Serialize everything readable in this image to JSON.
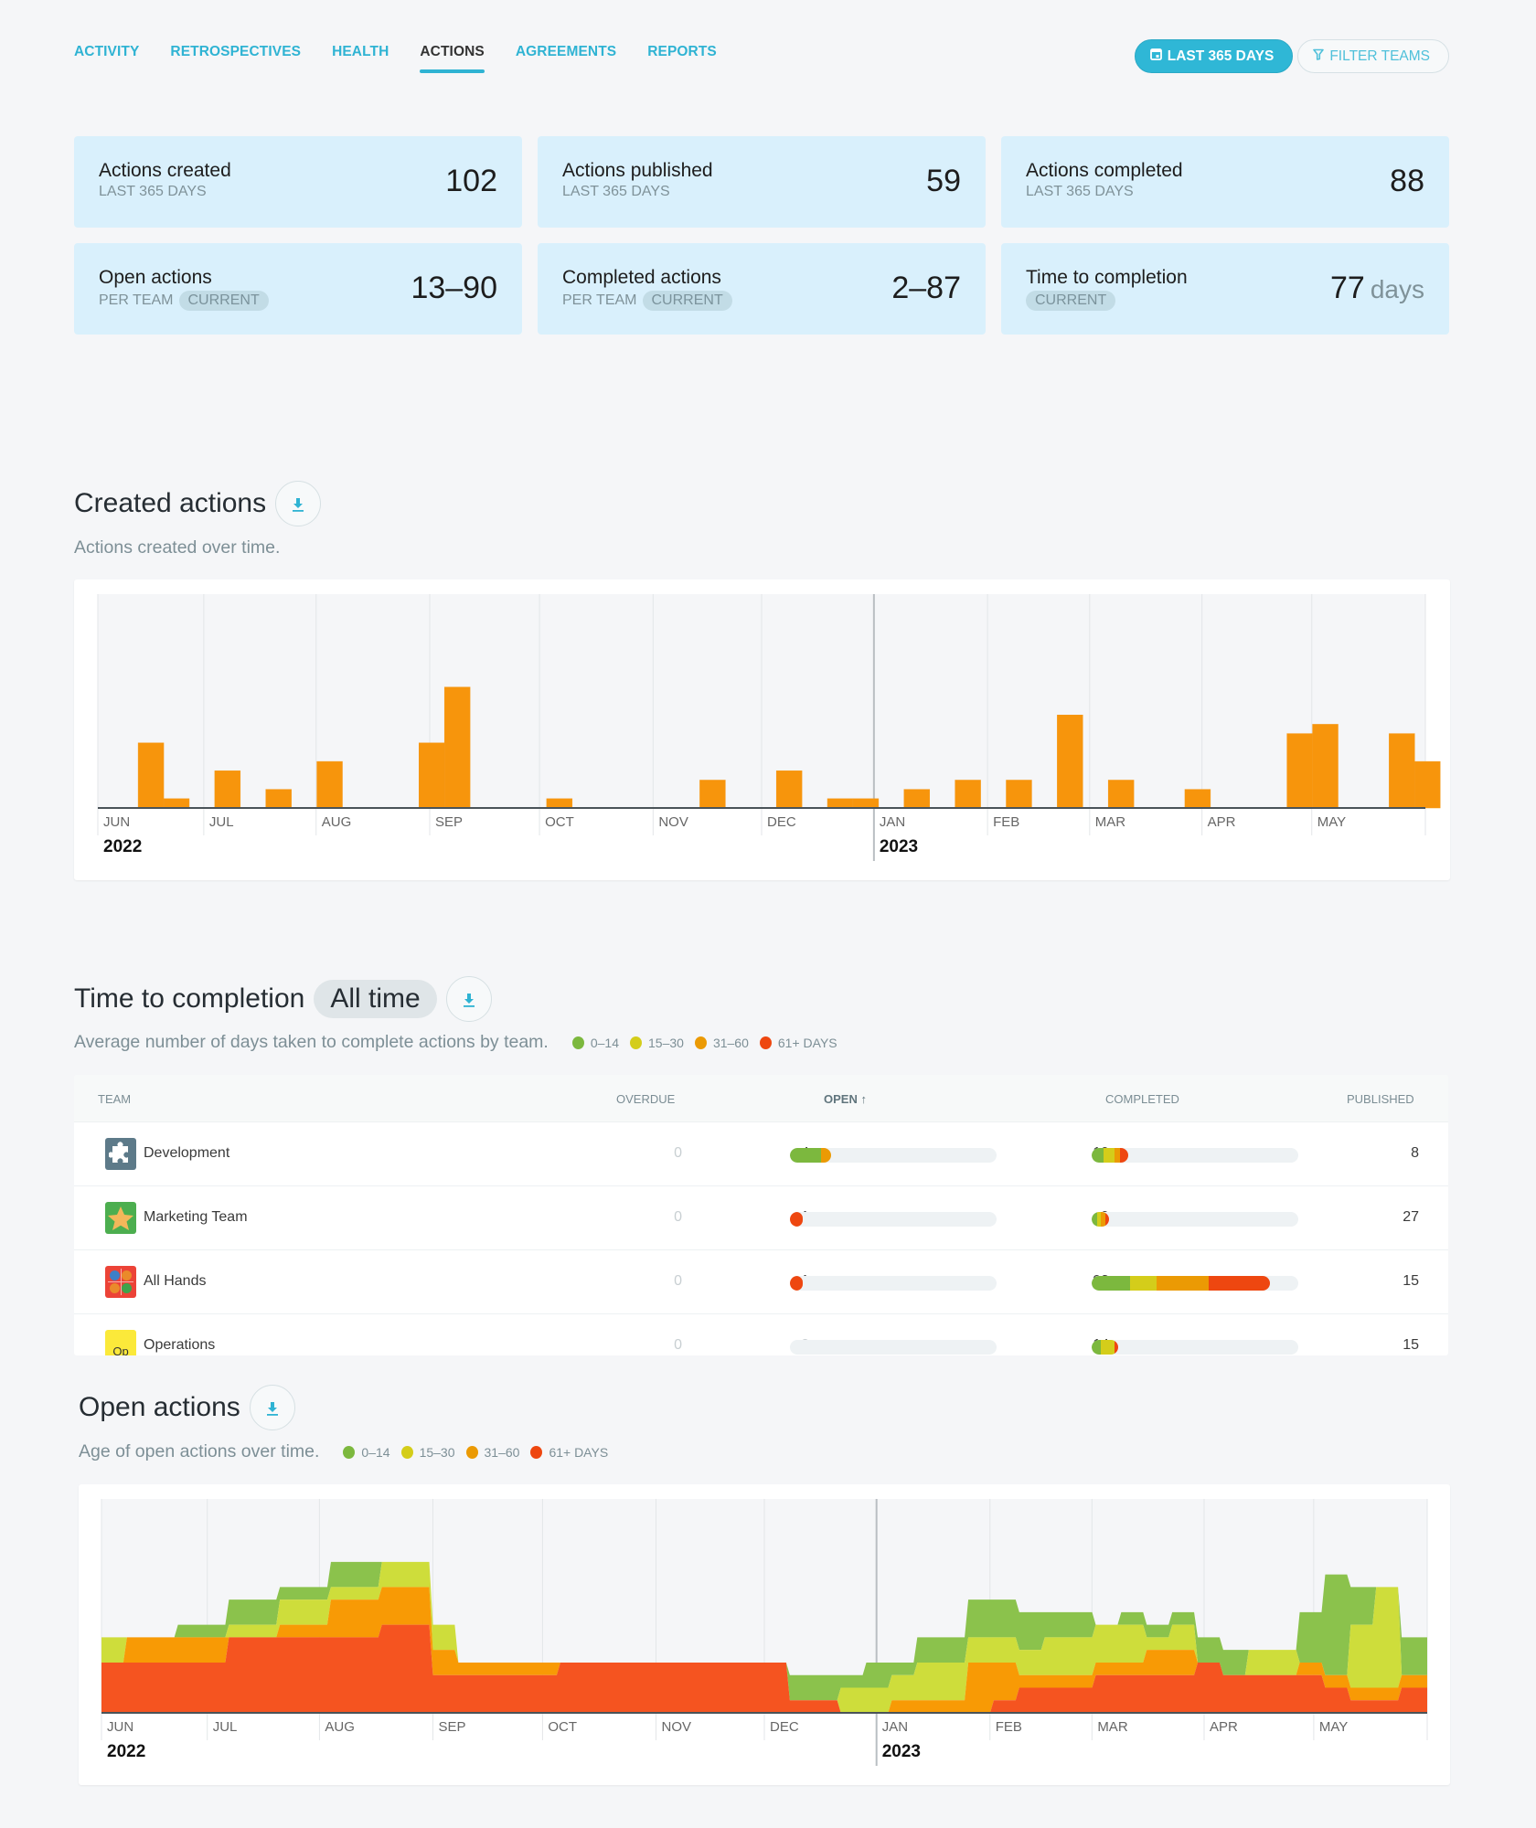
{
  "tabs": [
    {
      "label": "ACTIVITY",
      "active": false
    },
    {
      "label": "RETROSPECTIVES",
      "active": false
    },
    {
      "label": "HEALTH",
      "active": false
    },
    {
      "label": "ACTIONS",
      "active": true
    },
    {
      "label": "AGREEMENTS",
      "active": false
    },
    {
      "label": "REPORTS",
      "active": false
    }
  ],
  "toolbar": {
    "date_range_label": "LAST 365 DAYS",
    "filter_label": "FILTER TEAMS"
  },
  "cards": [
    {
      "title": "Actions created",
      "subtitle": "LAST 365 DAYS",
      "badge": "",
      "value": "102",
      "unit": ""
    },
    {
      "title": "Actions published",
      "subtitle": "LAST 365 DAYS",
      "badge": "",
      "value": "59",
      "unit": ""
    },
    {
      "title": "Actions completed",
      "subtitle": "LAST 365 DAYS",
      "badge": "",
      "value": "88",
      "unit": ""
    },
    {
      "title": "Open actions",
      "subtitle": "PER TEAM",
      "badge": "CURRENT",
      "value": "13–90",
      "unit": ""
    },
    {
      "title": "Completed actions",
      "subtitle": "PER TEAM",
      "badge": "CURRENT",
      "value": "2–87",
      "unit": ""
    },
    {
      "title": "Time to completion",
      "subtitle": "",
      "badge": "CURRENT",
      "value": "77",
      "unit": "days"
    }
  ],
  "created_section": {
    "title": "Created actions",
    "description": "Actions created over time."
  },
  "completion_section": {
    "title": "Time to completion",
    "period_badge": "All time",
    "description": "Average number of days taken to complete actions by team."
  },
  "open_section": {
    "title": "Open actions",
    "description": "Age of open actions over time."
  },
  "legend": [
    {
      "label": "0–14",
      "color": "#7cb83e"
    },
    {
      "label": "15–30",
      "color": "#d4cd1a"
    },
    {
      "label": "31–60",
      "color": "#eb9a04"
    },
    {
      "label": "61+ DAYS",
      "color": "#ee4710"
    }
  ],
  "table": {
    "columns": {
      "team": "TEAM",
      "overdue": "OVERDUE",
      "open": "OPEN",
      "open_sort": "↑",
      "completed": "COMPLETED",
      "published": "PUBLISHED"
    },
    "open_scale_max": 20,
    "completed_scale_max": 108,
    "rows": [
      {
        "team": "Development",
        "icon": "puzzle-icon",
        "overdue": "0",
        "open": "4",
        "open_segments": [
          3,
          0,
          1,
          0
        ],
        "completed": "19",
        "completed_segments": [
          6,
          6,
          3,
          4
        ],
        "published": "8"
      },
      {
        "team": "Marketing Team",
        "icon": "star-icon",
        "overdue": "0",
        "open": "1",
        "open_segments": [
          0,
          0,
          0,
          1
        ],
        "completed": "9",
        "completed_segments": [
          3,
          2,
          2,
          2
        ],
        "published": "27"
      },
      {
        "team": "All Hands",
        "icon": "faces-grid-icon",
        "overdue": "0",
        "open": "1",
        "open_segments": [
          0,
          0,
          0,
          1
        ],
        "completed": "93",
        "completed_segments": [
          20,
          14,
          27,
          32
        ],
        "published": "15"
      },
      {
        "team": "Operations",
        "icon": "op-initials-icon",
        "icon_text": "Op",
        "overdue": "0",
        "open": "0",
        "open_segments": [
          0,
          0,
          0,
          0
        ],
        "completed": "14",
        "completed_segments": [
          5,
          7,
          0,
          2
        ],
        "published": "15"
      }
    ]
  },
  "chart_data": [
    {
      "type": "bar",
      "title": "Created actions",
      "xlabel": "",
      "ylabel": "",
      "x_unit": "week",
      "weeks_total": 52,
      "months": [
        "JUN",
        "JUL",
        "AUG",
        "SEP",
        "OCT",
        "NOV",
        "DEC",
        "JAN",
        "FEB",
        "MAR",
        "APR",
        "MAY"
      ],
      "month_start_weeks": [
        0,
        4.15,
        8.55,
        13,
        17.3,
        21.75,
        26,
        30.4,
        34.85,
        38.85,
        43.25,
        47.55
      ],
      "years": [
        {
          "label": "2022",
          "month_index": 0
        },
        {
          "label": "2023",
          "month_index": 7
        }
      ],
      "color": "#f7950c",
      "bars": [
        {
          "week": 1,
          "value": 7
        },
        {
          "week": 2,
          "value": 1
        },
        {
          "week": 4,
          "value": 4
        },
        {
          "week": 6,
          "value": 2
        },
        {
          "week": 8,
          "value": 5
        },
        {
          "week": 12,
          "value": 7
        },
        {
          "week": 13,
          "value": 13
        },
        {
          "week": 17,
          "value": 1
        },
        {
          "week": 23,
          "value": 3
        },
        {
          "week": 26,
          "value": 4
        },
        {
          "week": 28,
          "value": 1
        },
        {
          "week": 29,
          "value": 1
        },
        {
          "week": 31,
          "value": 2
        },
        {
          "week": 33,
          "value": 3
        },
        {
          "week": 35,
          "value": 3
        },
        {
          "week": 37,
          "value": 10
        },
        {
          "week": 39,
          "value": 3
        },
        {
          "week": 42,
          "value": 2
        },
        {
          "week": 46,
          "value": 8
        },
        {
          "week": 47,
          "value": 9
        },
        {
          "week": 50,
          "value": 8
        },
        {
          "week": 51,
          "value": 5
        }
      ],
      "ylim": [
        0,
        23
      ]
    },
    {
      "type": "area",
      "stacked": true,
      "title": "Open actions",
      "x_unit": "week",
      "weeks_total": 52,
      "months": [
        "JUN",
        "JUL",
        "AUG",
        "SEP",
        "OCT",
        "NOV",
        "DEC",
        "JAN",
        "FEB",
        "MAR",
        "APR",
        "MAY"
      ],
      "month_start_weeks": [
        0,
        4.15,
        8.55,
        13,
        17.3,
        21.75,
        26,
        30.4,
        34.85,
        38.85,
        43.25,
        47.55
      ],
      "years": [
        {
          "label": "2022",
          "month_index": 0
        },
        {
          "label": "2023",
          "month_index": 7
        }
      ],
      "ylim": [
        0,
        17
      ],
      "series": [
        {
          "name": "61+ DAYS",
          "color": "#f55420",
          "values": [
            4,
            4,
            4,
            4,
            4,
            6,
            6,
            6,
            6,
            6,
            6,
            7,
            7,
            3,
            3,
            3,
            3,
            3,
            4,
            4,
            4,
            4,
            4,
            4,
            4,
            4,
            4,
            1,
            1,
            0,
            0,
            0,
            0,
            0,
            0,
            1,
            2,
            2,
            2,
            3,
            3,
            3,
            3,
            4,
            3,
            3,
            3,
            3,
            2,
            1,
            1,
            2,
            2
          ]
        },
        {
          "name": "31–60",
          "color": "#f89a05",
          "values": [
            0,
            2,
            2,
            2,
            2,
            0,
            0,
            1,
            1,
            3,
            3,
            3,
            3,
            2,
            1,
            1,
            1,
            1,
            0,
            0,
            0,
            0,
            0,
            0,
            0,
            0,
            0,
            0,
            0,
            0,
            0,
            1,
            1,
            1,
            4,
            3,
            1,
            1,
            1,
            1,
            1,
            2,
            2,
            0,
            0,
            0,
            0,
            1,
            1,
            1,
            1,
            1,
            1
          ]
        },
        {
          "name": "15–30",
          "color": "#cedd3b",
          "values": [
            2,
            0,
            0,
            0,
            0,
            1,
            1,
            2,
            2,
            1,
            1,
            2,
            2,
            2,
            0,
            0,
            0,
            0,
            0,
            0,
            0,
            0,
            0,
            0,
            0,
            0,
            0,
            0,
            0,
            2,
            2,
            2,
            3,
            3,
            2,
            2,
            2,
            3,
            3,
            3,
            3,
            1,
            2,
            0,
            0,
            2,
            2,
            0,
            0,
            5,
            8,
            0,
            0
          ]
        },
        {
          "name": "0–14",
          "color": "#8bc24c",
          "values": [
            0,
            0,
            0,
            1,
            1,
            2,
            2,
            1,
            1,
            2,
            2,
            0,
            0,
            0,
            0,
            0,
            0,
            0,
            0,
            0,
            0,
            0,
            0,
            0,
            0,
            0,
            0,
            2,
            2,
            1,
            2,
            1,
            2,
            2,
            3,
            3,
            3,
            2,
            2,
            0,
            1,
            1,
            1,
            2,
            2,
            0,
            0,
            4,
            8,
            3,
            0,
            3,
            3
          ]
        }
      ]
    }
  ]
}
